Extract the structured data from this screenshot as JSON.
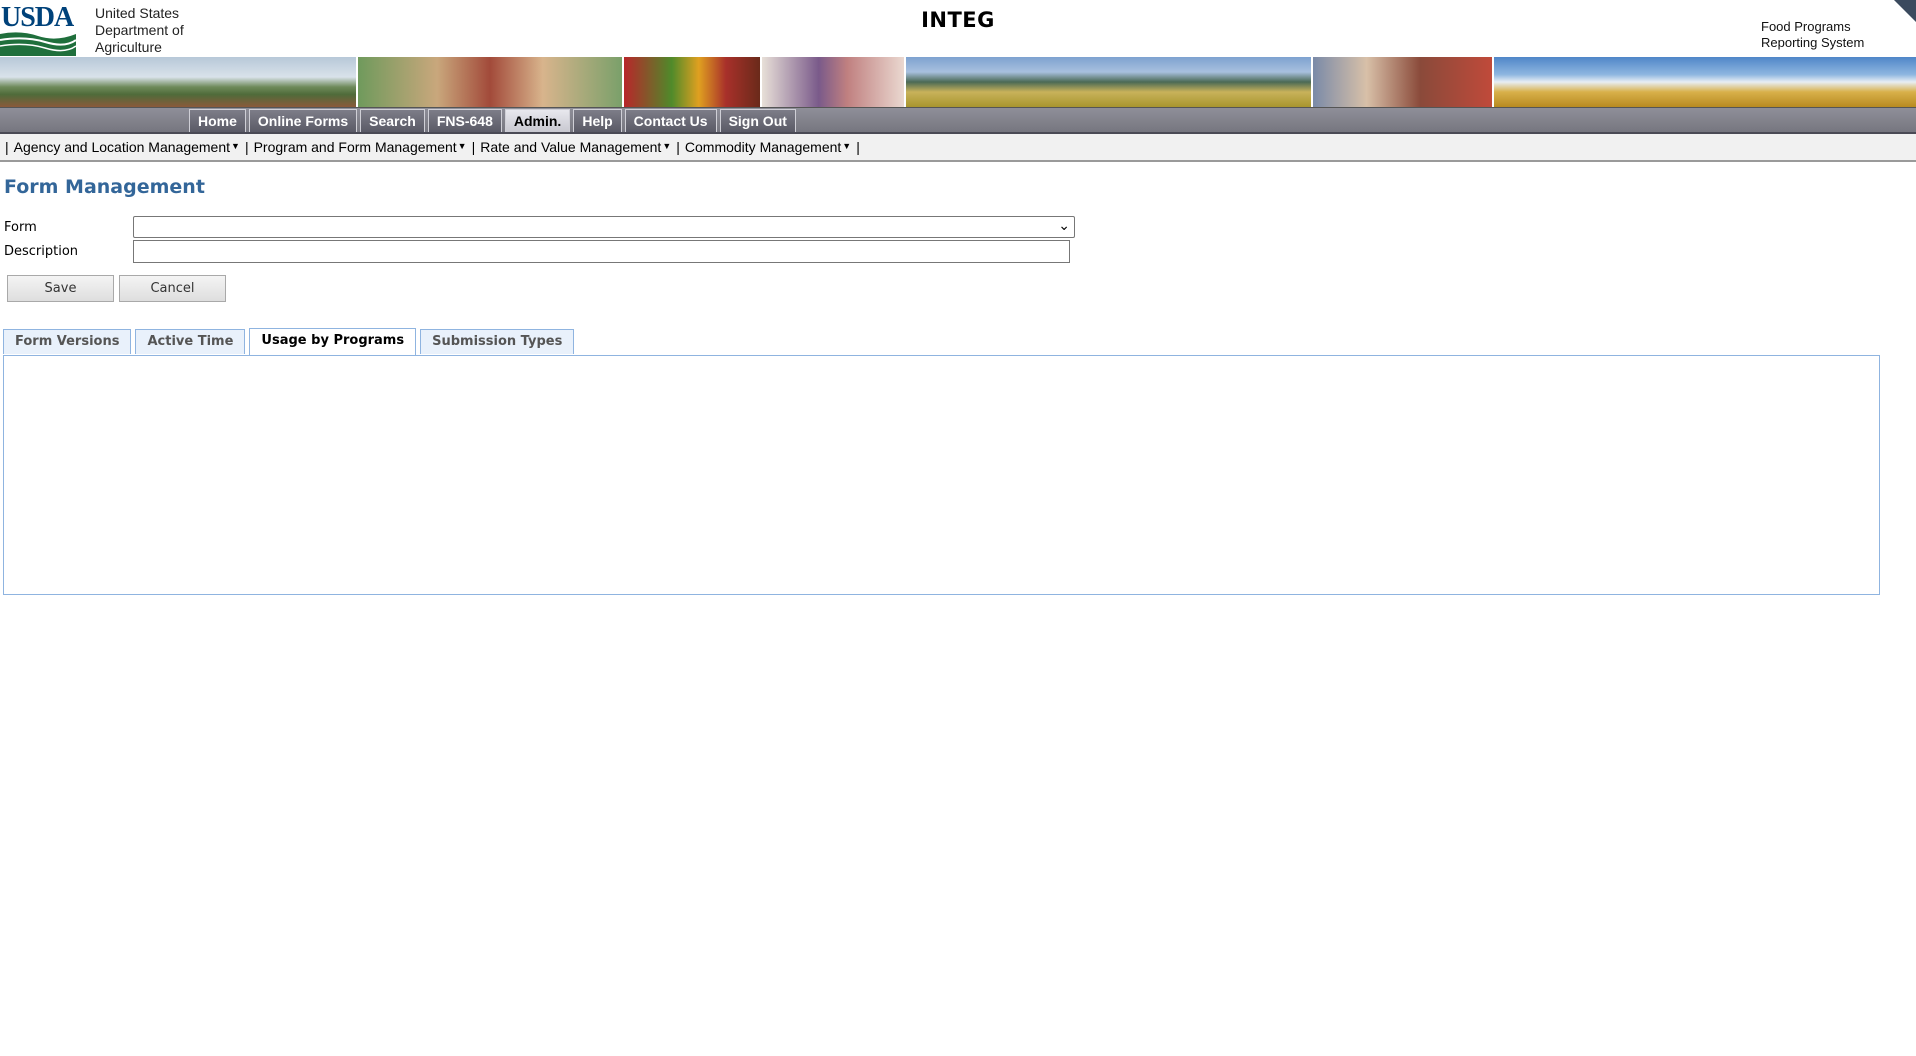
{
  "header": {
    "logo_text": "USDA",
    "agency_line1": "United States",
    "agency_line2": "Department of",
    "agency_line3": "Agriculture",
    "environment": "INTEG",
    "system_line1": "Food Programs",
    "system_line2": "Reporting System"
  },
  "main_nav": {
    "items": [
      {
        "label": "Home"
      },
      {
        "label": "Online Forms"
      },
      {
        "label": "Search"
      },
      {
        "label": "FNS-648"
      },
      {
        "label": "Admin."
      },
      {
        "label": "Help"
      },
      {
        "label": "Contact Us"
      },
      {
        "label": "Sign Out"
      }
    ],
    "active": "Admin."
  },
  "sub_nav": {
    "items": [
      {
        "label": "Agency and Location Management"
      },
      {
        "label": "Program and Form Management"
      },
      {
        "label": "Rate and Value Management"
      },
      {
        "label": "Commodity Management"
      }
    ]
  },
  "page": {
    "title": "Form Management",
    "form_label": "Form",
    "form_value": "",
    "description_label": "Description",
    "description_value": ""
  },
  "buttons": {
    "save": "Save",
    "cancel": "Cancel"
  },
  "tabs": {
    "items": [
      {
        "label": "Form Versions"
      },
      {
        "label": "Active Time"
      },
      {
        "label": "Usage by Programs"
      },
      {
        "label": "Submission Types"
      }
    ],
    "active": "Usage by Programs"
  },
  "colors": {
    "title": "#336699",
    "nav_bg": "#76767f",
    "tab_border": "#8fb4e0",
    "usda_blue": "#00427a",
    "usda_green": "#1f6f3c"
  }
}
